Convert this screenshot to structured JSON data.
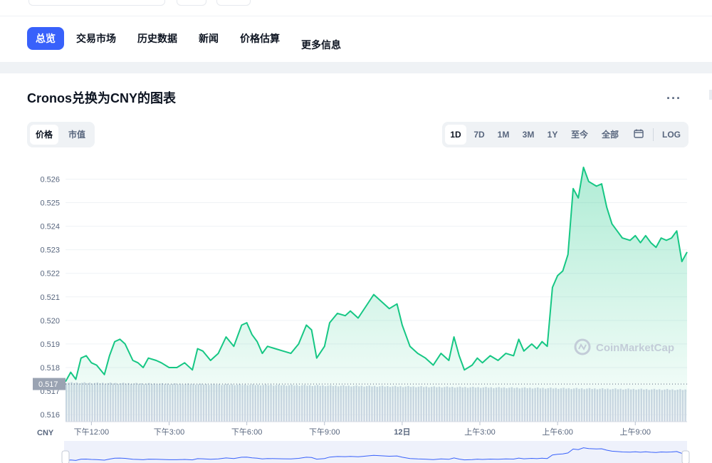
{
  "nav": {
    "tabs": [
      {
        "label": "总览",
        "active": true
      },
      {
        "label": "交易市场",
        "active": false
      },
      {
        "label": "历史数据",
        "active": false
      },
      {
        "label": "新闻",
        "active": false
      },
      {
        "label": "价格估算",
        "active": false
      },
      {
        "label": "更多信息",
        "active": false
      }
    ]
  },
  "chart_header": {
    "title": "Cronos兑换为CNY的图表",
    "more_label": "···",
    "view_toggle": [
      {
        "label": "价格",
        "active": true
      },
      {
        "label": "市值",
        "active": false
      }
    ],
    "ranges": [
      {
        "label": "1D",
        "active": true
      },
      {
        "label": "7D",
        "active": false
      },
      {
        "label": "1M",
        "active": false
      },
      {
        "label": "3M",
        "active": false
      },
      {
        "label": "1Y",
        "active": false
      },
      {
        "label": "至今",
        "active": false
      },
      {
        "label": "全部",
        "active": false
      }
    ],
    "calendar_icon": "calendar-icon",
    "log_label": "LOG"
  },
  "colors": {
    "accent": "#3861fb",
    "line": "#16c784",
    "volume": "#cfd6e4",
    "price_tag": "#9aa3b2"
  },
  "chart_data": {
    "type": "area",
    "title": "Cronos兑换为CNY的图表",
    "unit_label": "CNY",
    "y_ticks": [
      0.516,
      0.517,
      0.518,
      0.519,
      0.52,
      0.521,
      0.522,
      0.523,
      0.524,
      0.525,
      0.526
    ],
    "ylim": [
      0.5157,
      0.5268
    ],
    "x_range": [
      0,
      24
    ],
    "x_ticks": [
      {
        "x": 1.0,
        "label": "下午12:00"
      },
      {
        "x": 4.0,
        "label": "下午3:00"
      },
      {
        "x": 7.0,
        "label": "下午6:00"
      },
      {
        "x": 10.0,
        "label": "下午9:00"
      },
      {
        "x": 13.0,
        "label": "12日",
        "bold": true
      },
      {
        "x": 16.0,
        "label": "上午3:00"
      },
      {
        "x": 19.0,
        "label": "上午6:00"
      },
      {
        "x": 22.0,
        "label": "上午9:00"
      }
    ],
    "reference_price": 0.5173,
    "reference_label": "0.517",
    "watermark": "CoinMarketCap",
    "grid": true,
    "series": [
      {
        "x": [
          0,
          0.2,
          0.4,
          0.6,
          0.8,
          1.0,
          1.2,
          1.5,
          1.7,
          1.9,
          2.1,
          2.3,
          2.6,
          2.8,
          3.0,
          3.2,
          3.5,
          3.7,
          4.0,
          4.3,
          4.6,
          4.9,
          5.1,
          5.3,
          5.6,
          5.9,
          6.2,
          6.5,
          6.8,
          7.0,
          7.2,
          7.4,
          7.6,
          7.8,
          8.1,
          8.4,
          8.7,
          9.0,
          9.3,
          9.5,
          9.7,
          10.0,
          10.2,
          10.5,
          10.8,
          11.0,
          11.3,
          11.6,
          11.9,
          12.2,
          12.5,
          12.8,
          13.0,
          13.3,
          13.6,
          13.9,
          14.2,
          14.5,
          14.8,
          15.0,
          15.2,
          15.4,
          15.7,
          15.9,
          16.1,
          16.4,
          16.7,
          17.0,
          17.3,
          17.5,
          17.7,
          18.0,
          18.2,
          18.4,
          18.6,
          18.8,
          19.0,
          19.2,
          19.4,
          19.6,
          19.8,
          20.0,
          20.2,
          20.5,
          20.7,
          20.9,
          21.1,
          21.3,
          21.5,
          21.8,
          22.0,
          22.2,
          22.4,
          22.6,
          22.8,
          23.0,
          23.2,
          23.4,
          23.6,
          23.8,
          24.0
        ],
        "y": [
          0.5174,
          0.5178,
          0.5175,
          0.5184,
          0.5185,
          0.5182,
          0.5181,
          0.5177,
          0.5185,
          0.5191,
          0.5192,
          0.519,
          0.5183,
          0.5182,
          0.518,
          0.5184,
          0.5183,
          0.5182,
          0.518,
          0.518,
          0.5182,
          0.5179,
          0.5188,
          0.5187,
          0.5183,
          0.5186,
          0.5193,
          0.5189,
          0.5198,
          0.5199,
          0.5194,
          0.5191,
          0.5186,
          0.5189,
          0.5188,
          0.5187,
          0.5186,
          0.519,
          0.5198,
          0.5196,
          0.5184,
          0.5189,
          0.5199,
          0.5203,
          0.5202,
          0.5204,
          0.5201,
          0.5206,
          0.5211,
          0.5208,
          0.5205,
          0.5207,
          0.5198,
          0.5189,
          0.5186,
          0.5184,
          0.5181,
          0.5186,
          0.5183,
          0.5193,
          0.5185,
          0.5179,
          0.5181,
          0.5184,
          0.5182,
          0.5185,
          0.5183,
          0.5186,
          0.5185,
          0.5192,
          0.5187,
          0.519,
          0.5188,
          0.5191,
          0.5189,
          0.5214,
          0.5219,
          0.5221,
          0.5228,
          0.5256,
          0.5252,
          0.5265,
          0.5259,
          0.5257,
          0.5258,
          0.5248,
          0.5241,
          0.5238,
          0.5235,
          0.5234,
          0.5236,
          0.5233,
          0.5236,
          0.5233,
          0.5231,
          0.5235,
          0.5234,
          0.5235,
          0.5238,
          0.5225,
          0.5229
        ]
      }
    ]
  }
}
